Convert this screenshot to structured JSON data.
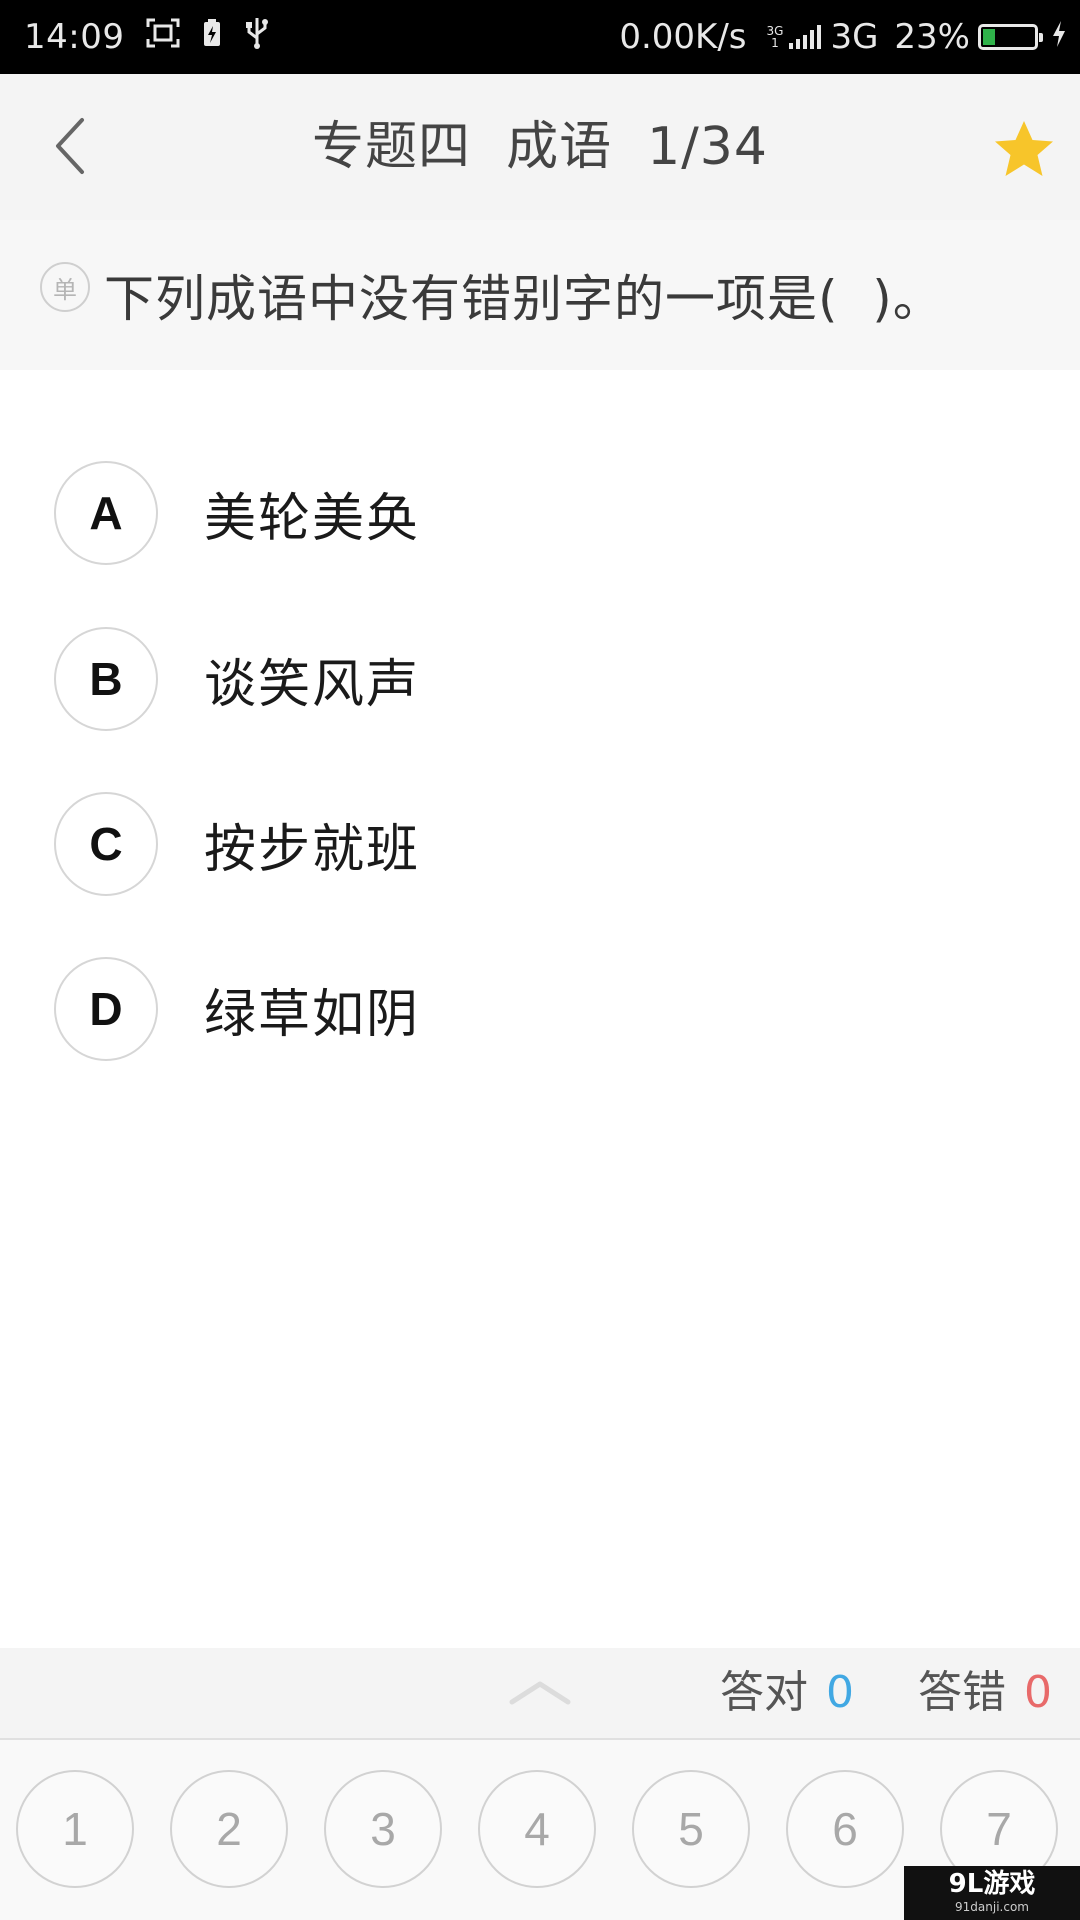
{
  "status_bar": {
    "time": "14:09",
    "network_speed": "0.00K/s",
    "network_type_small_top": "3G",
    "network_type_small_bottom": "1",
    "network_type": "3G",
    "battery_percent": "23%",
    "battery_level": 0.23,
    "battery_color": "#2fb24a"
  },
  "header": {
    "title": "专题四  成语  1/34",
    "favorite_color": "#f7c52a"
  },
  "question": {
    "type_badge": "单",
    "text": "下列成语中没有错别字的一项是(  )。"
  },
  "options": [
    {
      "letter": "A",
      "text": "美轮美奂"
    },
    {
      "letter": "B",
      "text": "谈笑风声"
    },
    {
      "letter": "C",
      "text": "按步就班"
    },
    {
      "letter": "D",
      "text": "绿草如阴"
    }
  ],
  "score": {
    "correct_label": "答对",
    "correct_count": "0",
    "correct_color": "#41a8e3",
    "wrong_label": "答错",
    "wrong_count": "0",
    "wrong_color": "#e86a6a"
  },
  "question_numbers": [
    "1",
    "2",
    "3",
    "4",
    "5",
    "6",
    "7"
  ],
  "watermark": {
    "main": "9L游戏",
    "sub": "91danji.com"
  }
}
